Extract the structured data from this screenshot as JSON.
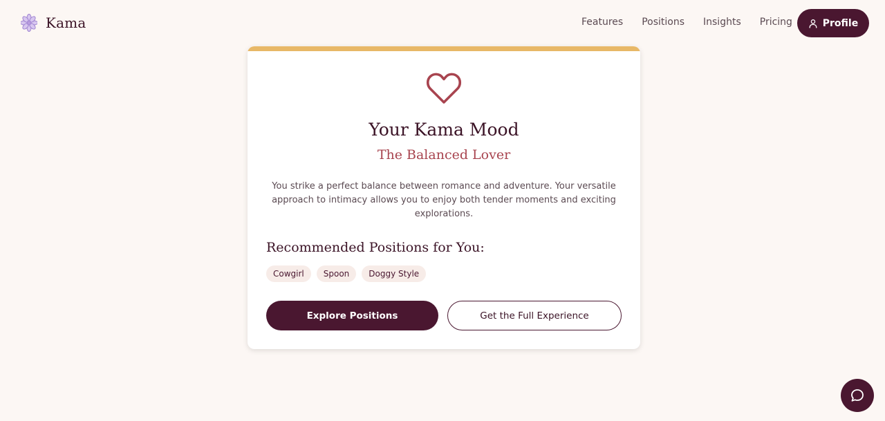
{
  "brand": {
    "name": "Kama",
    "logo_icon": "lotus-flower-icon"
  },
  "nav": {
    "links": [
      "Features",
      "Positions",
      "Insights",
      "Pricing"
    ],
    "profile_label": "Profile",
    "profile_icon": "user-icon"
  },
  "card": {
    "icon": "heart-icon",
    "title": "Your Kama Mood",
    "subtitle": "The Balanced Lover",
    "description": "You strike a perfect balance between romance and adventure. Your versatile approach to intimacy allows you to enjoy both tender moments and exciting explorations.",
    "recommended_title": "Recommended Positions for You:",
    "tags": [
      "Cowgirl",
      "Spoon",
      "Doggy Style"
    ],
    "primary_button": "Explore Positions",
    "secondary_button": "Get the Full Experience"
  },
  "chat": {
    "icon": "chat-bubble-icon"
  },
  "colors": {
    "background": "#fcf7f4",
    "primary": "#4a1730",
    "accent_bar": "#e8b867",
    "heart": "#a8444f",
    "subtitle": "#a8444f",
    "tag_background": "#f7ece8"
  }
}
